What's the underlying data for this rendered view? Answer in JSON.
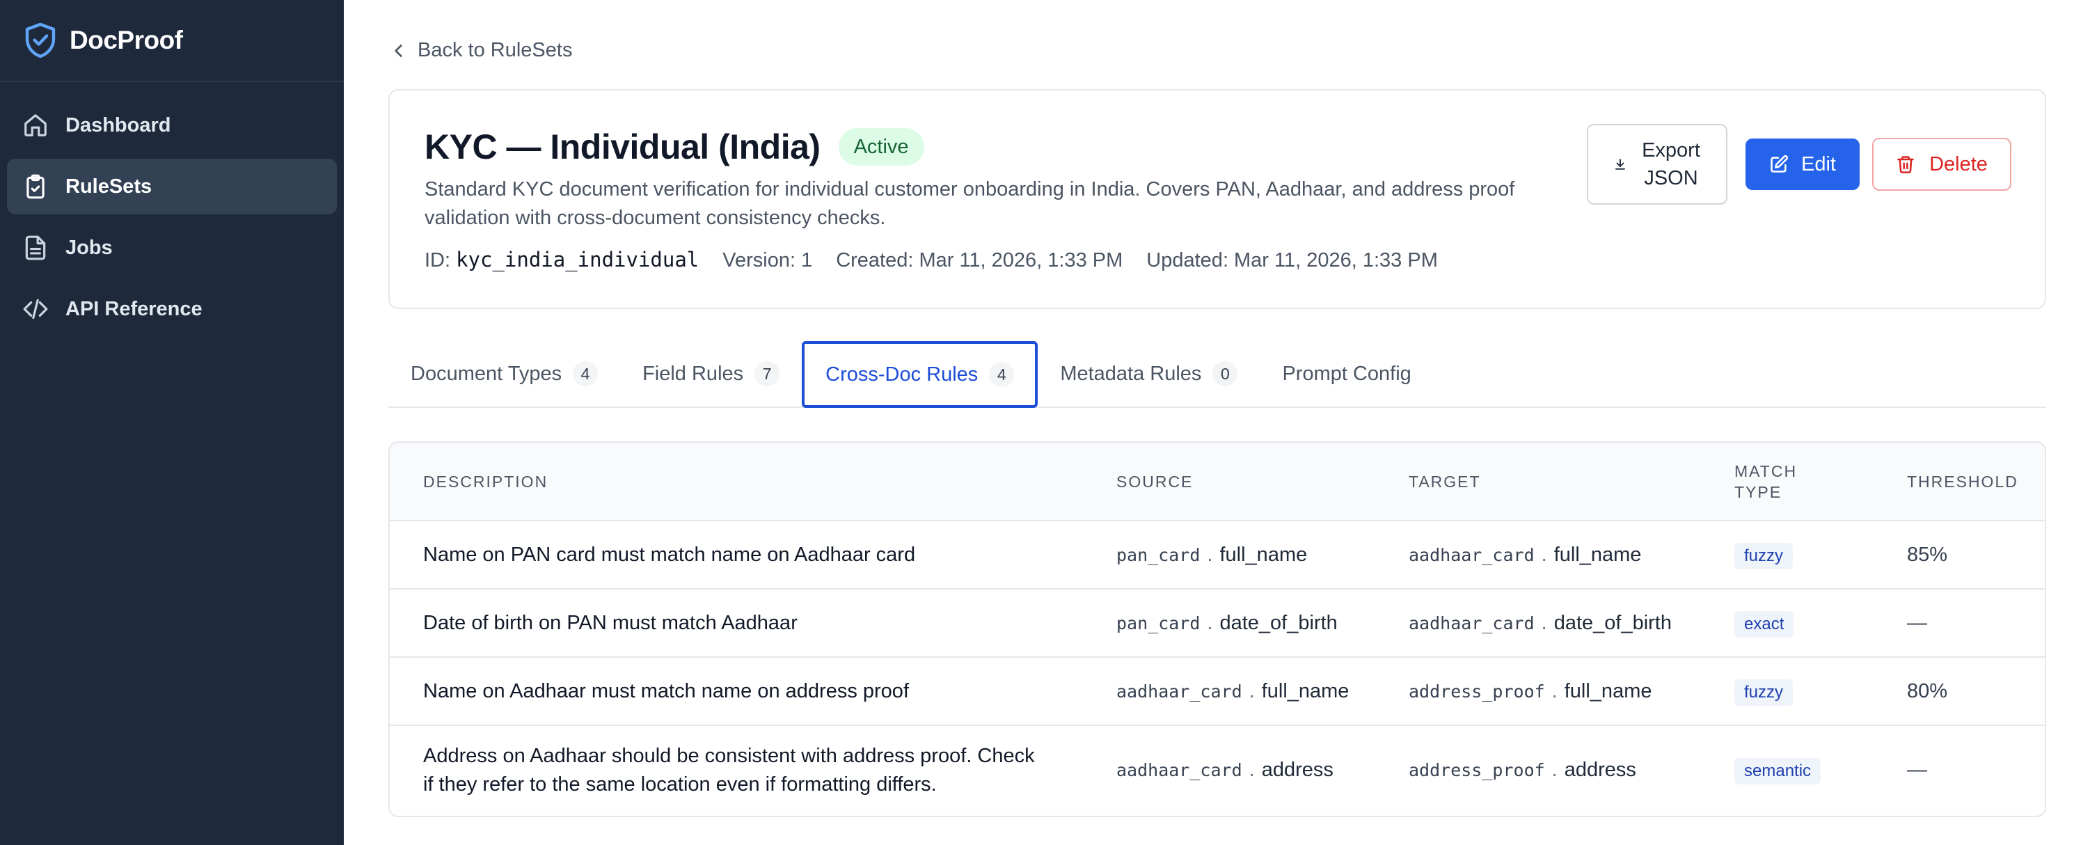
{
  "app": {
    "name": "DocProof"
  },
  "sidebar": {
    "items": [
      {
        "label": "Dashboard",
        "icon": "home-icon",
        "active": false
      },
      {
        "label": "RuleSets",
        "icon": "clipboard-check-icon",
        "active": true
      },
      {
        "label": "Jobs",
        "icon": "file-text-icon",
        "active": false
      },
      {
        "label": "API Reference",
        "icon": "code-icon",
        "active": false
      }
    ]
  },
  "back_link": "Back to RuleSets",
  "ruleset": {
    "title": "KYC — Individual (India)",
    "status": "Active",
    "description": "Standard KYC document verification for individual customer onboarding in India. Covers PAN, Aadhaar, and address proof validation with cross-document consistency checks.",
    "id_label": "ID:",
    "id_value": "kyc_india_individual",
    "version_label": "Version:",
    "version_value": "1",
    "created_label": "Created:",
    "created_value": "Mar 11, 2026, 1:33 PM",
    "updated_label": "Updated:",
    "updated_value": "Mar 11, 2026, 1:33 PM"
  },
  "actions": {
    "export_line1": "Export",
    "export_line2": "JSON",
    "edit": "Edit",
    "delete": "Delete"
  },
  "tabs": [
    {
      "label": "Document Types",
      "count": "4",
      "active": false
    },
    {
      "label": "Field Rules",
      "count": "7",
      "active": false
    },
    {
      "label": "Cross-Doc Rules",
      "count": "4",
      "active": true
    },
    {
      "label": "Metadata Rules",
      "count": "0",
      "active": false
    },
    {
      "label": "Prompt Config",
      "count": "",
      "active": false
    }
  ],
  "table": {
    "headers": {
      "description": "DESCRIPTION",
      "source": "SOURCE",
      "target": "TARGET",
      "match_type_1": "MATCH",
      "match_type_2": "TYPE",
      "threshold": "THRESHOLD"
    },
    "rows": [
      {
        "description": "Name on PAN card must match name on Aadhaar card",
        "source_doc": "pan_card",
        "source_field": "full_name",
        "target_doc": "aadhaar_card",
        "target_field": "full_name",
        "match_type": "fuzzy",
        "threshold": "85%"
      },
      {
        "description": "Date of birth on PAN must match Aadhaar",
        "source_doc": "pan_card",
        "source_field": "date_of_birth",
        "target_doc": "aadhaar_card",
        "target_field": "date_of_birth",
        "match_type": "exact",
        "threshold": "—"
      },
      {
        "description": "Name on Aadhaar must match name on address proof",
        "source_doc": "aadhaar_card",
        "source_field": "full_name",
        "target_doc": "address_proof",
        "target_field": "full_name",
        "match_type": "fuzzy",
        "threshold": "80%"
      },
      {
        "description": "Address on Aadhaar should be consistent with address proof. Check if they refer to the same location even if formatting differs.",
        "source_doc": "aadhaar_card",
        "source_field": "address",
        "target_doc": "address_proof",
        "target_field": "address",
        "match_type": "semantic",
        "threshold": "—"
      }
    ]
  },
  "colors": {
    "sidebar_bg": "#1e293b",
    "accent": "#2563eb",
    "danger": "#dc2626",
    "active_badge_bg": "#dcfce7",
    "active_badge_text": "#166534"
  }
}
